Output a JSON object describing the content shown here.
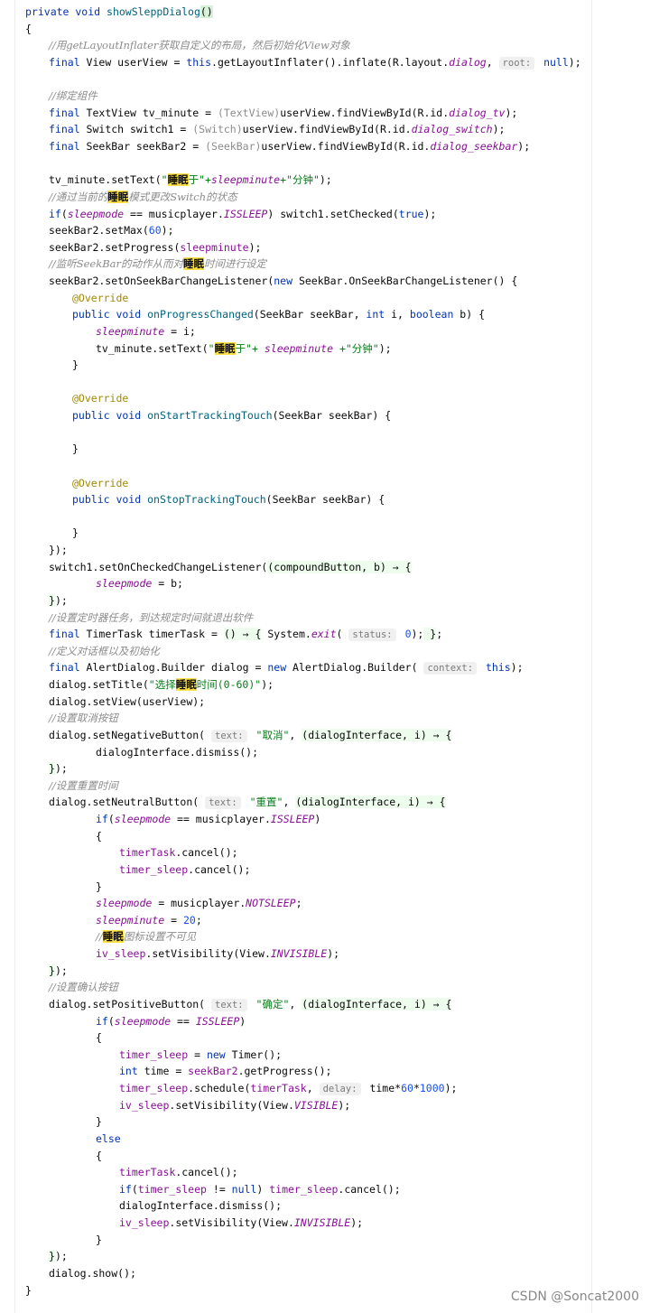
{
  "lines": [
    {
      "i": 0,
      "t": [
        [
          "kw",
          "private void "
        ],
        [
          "mname",
          "showSleppDialog"
        ],
        [
          "hlbrace",
          "()"
        ]
      ]
    },
    {
      "i": 0,
      "t": [
        [
          "p",
          "{"
        ]
      ]
    },
    {
      "i": 1,
      "t": [
        [
          "cm",
          "//用getLayoutInflater获取自定义的布局，然后初始化View对象"
        ]
      ]
    },
    {
      "i": 1,
      "t": [
        [
          "kw",
          "final "
        ],
        [
          "p",
          "View userView = "
        ],
        [
          "kw",
          "this"
        ],
        [
          "p",
          ".getLayoutInflater().inflate(R.layout."
        ],
        [
          "ital",
          "dialog"
        ],
        [
          "p",
          ", "
        ],
        [
          "hint",
          "root:"
        ],
        [
          "kw",
          " null"
        ],
        [
          "p",
          ");"
        ]
      ]
    },
    {
      "i": 1,
      "t": [
        [
          "p",
          ""
        ]
      ]
    },
    {
      "i": 1,
      "t": [
        [
          "cm",
          "//绑定组件"
        ]
      ]
    },
    {
      "i": 1,
      "t": [
        [
          "kw",
          "final "
        ],
        [
          "p",
          "TextView tv_minute = "
        ],
        [
          "cast",
          "(TextView)"
        ],
        [
          "p",
          "userView.findViewById(R.id."
        ],
        [
          "ital",
          "dialog_tv"
        ],
        [
          "p",
          ");"
        ]
      ]
    },
    {
      "i": 1,
      "t": [
        [
          "kw",
          "final "
        ],
        [
          "p",
          "Switch switch1 = "
        ],
        [
          "cast",
          "(Switch)"
        ],
        [
          "p",
          "userView.findViewById(R.id."
        ],
        [
          "ital",
          "dialog_switch"
        ],
        [
          "p",
          ");"
        ]
      ]
    },
    {
      "i": 1,
      "t": [
        [
          "kw",
          "final "
        ],
        [
          "p",
          "SeekBar seekBar2 = "
        ],
        [
          "cast",
          "(SeekBar)"
        ],
        [
          "p",
          "userView.findViewById(R.id."
        ],
        [
          "ital",
          "dialog_seekbar"
        ],
        [
          "p",
          ");"
        ]
      ]
    },
    {
      "i": 1,
      "t": [
        [
          "p",
          ""
        ]
      ]
    },
    {
      "i": 1,
      "t": [
        [
          "p",
          "tv_minute.setText("
        ],
        [
          "str",
          "\""
        ],
        [
          "hlw",
          "睡眠"
        ],
        [
          "str",
          "于\"+"
        ],
        [
          "field",
          "sleepminute"
        ],
        [
          "str",
          "+\"分钟\""
        ],
        [
          "p",
          ");"
        ]
      ]
    },
    {
      "i": 1,
      "t": [
        [
          "cm",
          "//通过当前的"
        ],
        [
          "hlw",
          "睡眠"
        ],
        [
          "cm",
          "模式更改Switch的状态"
        ]
      ]
    },
    {
      "i": 1,
      "t": [
        [
          "kw",
          "if"
        ],
        [
          "p",
          "("
        ],
        [
          "field",
          "sleepmode"
        ],
        [
          "p",
          " == musicplayer."
        ],
        [
          "stat",
          "ISSLEEP"
        ],
        [
          "p",
          ") switch1.setChecked("
        ],
        [
          "kw",
          "true"
        ],
        [
          "p",
          ");"
        ]
      ]
    },
    {
      "i": 1,
      "t": [
        [
          "p",
          "seekBar2.setMax("
        ],
        [
          "num",
          "60"
        ],
        [
          "p",
          ");"
        ]
      ]
    },
    {
      "i": 1,
      "t": [
        [
          "p",
          "seekBar2.setProgress("
        ],
        [
          "var",
          "sleepminute"
        ],
        [
          "p",
          ");"
        ]
      ]
    },
    {
      "i": 1,
      "t": [
        [
          "cm",
          "//监听SeekBar的动作从而对"
        ],
        [
          "hlw",
          "睡眠"
        ],
        [
          "cm",
          "时间进行设定"
        ]
      ]
    },
    {
      "i": 1,
      "t": [
        [
          "p",
          "seekBar2.setOnSeekBarChangeListener("
        ],
        [
          "kw",
          "new "
        ],
        [
          "p",
          "SeekBar.OnSeekBarChangeListener() {"
        ]
      ]
    },
    {
      "i": 2,
      "t": [
        [
          "ann",
          "@Override"
        ]
      ]
    },
    {
      "i": 2,
      "t": [
        [
          "kw",
          "public void "
        ],
        [
          "mname",
          "onProgressChanged"
        ],
        [
          "p",
          "(SeekBar seekBar, "
        ],
        [
          "kw",
          "int "
        ],
        [
          "p",
          "i, "
        ],
        [
          "kw",
          "boolean "
        ],
        [
          "p",
          "b) {"
        ]
      ]
    },
    {
      "i": 3,
      "t": [
        [
          "field",
          "sleepminute"
        ],
        [
          "p",
          " = i;"
        ]
      ]
    },
    {
      "i": 3,
      "t": [
        [
          "p",
          "tv_minute.setText("
        ],
        [
          "str",
          "\""
        ],
        [
          "hlw",
          "睡眠"
        ],
        [
          "str",
          "于\"+ "
        ],
        [
          "field",
          "sleepminute"
        ],
        [
          "str",
          " +\"分钟\""
        ],
        [
          "p",
          ");"
        ]
      ]
    },
    {
      "i": 2,
      "t": [
        [
          "p",
          "}"
        ]
      ]
    },
    {
      "i": 2,
      "t": [
        [
          "p",
          ""
        ]
      ]
    },
    {
      "i": 2,
      "t": [
        [
          "ann",
          "@Override"
        ]
      ]
    },
    {
      "i": 2,
      "t": [
        [
          "kw",
          "public void "
        ],
        [
          "mname",
          "onStartTrackingTouch"
        ],
        [
          "p",
          "(SeekBar seekBar) {"
        ]
      ]
    },
    {
      "i": 2,
      "t": [
        [
          "p",
          ""
        ]
      ]
    },
    {
      "i": 2,
      "t": [
        [
          "p",
          "}"
        ]
      ]
    },
    {
      "i": 2,
      "t": [
        [
          "p",
          ""
        ]
      ]
    },
    {
      "i": 2,
      "t": [
        [
          "ann",
          "@Override"
        ]
      ]
    },
    {
      "i": 2,
      "t": [
        [
          "kw",
          "public void "
        ],
        [
          "mname",
          "onStopTrackingTouch"
        ],
        [
          "p",
          "(SeekBar seekBar) {"
        ]
      ]
    },
    {
      "i": 2,
      "t": [
        [
          "p",
          ""
        ]
      ]
    },
    {
      "i": 2,
      "t": [
        [
          "p",
          "}"
        ]
      ]
    },
    {
      "i": 1,
      "t": [
        [
          "p",
          "});"
        ]
      ]
    },
    {
      "i": 1,
      "t": [
        [
          "p",
          "switch1.setOnCheckedChangeListener("
        ],
        [
          "lam",
          "(compoundButton, b) → {"
        ]
      ]
    },
    {
      "i": 3,
      "t": [
        [
          "field",
          "sleepmode"
        ],
        [
          "p",
          " = b;"
        ]
      ]
    },
    {
      "i": 1,
      "t": [
        [
          "lam",
          "}"
        ],
        [
          "p",
          ");"
        ]
      ]
    },
    {
      "i": 1,
      "t": [
        [
          "cm",
          "//设置定时器任务，到达规定时间就退出软件"
        ]
      ]
    },
    {
      "i": 1,
      "t": [
        [
          "kw",
          "final "
        ],
        [
          "p",
          "TimerTask timerTask = "
        ],
        [
          "lam",
          "() → {"
        ],
        [
          "p",
          " System."
        ],
        [
          "stat",
          "exit"
        ],
        [
          "p",
          "( "
        ],
        [
          "hint",
          "status:"
        ],
        [
          "num",
          " 0"
        ],
        [
          "p",
          ");"
        ],
        [
          "lam",
          " }"
        ],
        [
          "p",
          ";"
        ]
      ]
    },
    {
      "i": 1,
      "t": [
        [
          "cm",
          "//定义对话框以及初始化"
        ]
      ]
    },
    {
      "i": 1,
      "t": [
        [
          "kw",
          "final "
        ],
        [
          "p",
          "AlertDialog.Builder dialog = "
        ],
        [
          "kw",
          "new "
        ],
        [
          "p",
          "AlertDialog.Builder( "
        ],
        [
          "hint",
          "context:"
        ],
        [
          "kw",
          " this"
        ],
        [
          "p",
          ");"
        ]
      ]
    },
    {
      "i": 1,
      "t": [
        [
          "p",
          "dialog.setTitle("
        ],
        [
          "str",
          "\"选择"
        ],
        [
          "hlw",
          "睡眠"
        ],
        [
          "str",
          "时间(0-60)\""
        ],
        [
          "p",
          ");"
        ]
      ]
    },
    {
      "i": 1,
      "t": [
        [
          "p",
          "dialog.setView(userView);"
        ]
      ]
    },
    {
      "i": 1,
      "t": [
        [
          "cm",
          "//设置取消按钮"
        ]
      ]
    },
    {
      "i": 1,
      "t": [
        [
          "p",
          "dialog.setNegativeButton( "
        ],
        [
          "hint",
          "text:"
        ],
        [
          "str",
          " \"取消\""
        ],
        [
          "p",
          ", "
        ],
        [
          "lam",
          "(dialogInterface, i) → {"
        ]
      ]
    },
    {
      "i": 3,
      "t": [
        [
          "p",
          "dialogInterface.dismiss();"
        ]
      ]
    },
    {
      "i": 1,
      "t": [
        [
          "lam",
          "}"
        ],
        [
          "p",
          ");"
        ]
      ]
    },
    {
      "i": 1,
      "t": [
        [
          "cm",
          "//设置重置时间"
        ]
      ]
    },
    {
      "i": 1,
      "t": [
        [
          "p",
          "dialog.setNeutralButton( "
        ],
        [
          "hint",
          "text:"
        ],
        [
          "str",
          " \"重置\""
        ],
        [
          "p",
          ", "
        ],
        [
          "lam",
          "(dialogInterface, i) → {"
        ]
      ]
    },
    {
      "i": 3,
      "t": [
        [
          "kw",
          "if"
        ],
        [
          "p",
          "("
        ],
        [
          "field",
          "sleepmode"
        ],
        [
          "p",
          " == musicplayer."
        ],
        [
          "stat",
          "ISSLEEP"
        ],
        [
          "p",
          ")"
        ]
      ]
    },
    {
      "i": 3,
      "t": [
        [
          "p",
          "{"
        ]
      ]
    },
    {
      "i": 4,
      "t": [
        [
          "var",
          "timerTask"
        ],
        [
          "p",
          ".cancel();"
        ]
      ]
    },
    {
      "i": 4,
      "t": [
        [
          "var",
          "timer_sleep"
        ],
        [
          "p",
          ".cancel();"
        ]
      ]
    },
    {
      "i": 3,
      "t": [
        [
          "p",
          "}"
        ]
      ]
    },
    {
      "i": 3,
      "t": [
        [
          "field",
          "sleepmode"
        ],
        [
          "p",
          " = musicplayer."
        ],
        [
          "stat",
          "NOTSLEEP"
        ],
        [
          "p",
          ";"
        ]
      ]
    },
    {
      "i": 3,
      "t": [
        [
          "field",
          "sleepminute"
        ],
        [
          "p",
          " = "
        ],
        [
          "num",
          "20"
        ],
        [
          "p",
          ";"
        ]
      ]
    },
    {
      "i": 3,
      "t": [
        [
          "cm",
          "//"
        ],
        [
          "hlw",
          "睡眠"
        ],
        [
          "cm",
          "图标设置不可见"
        ]
      ]
    },
    {
      "i": 3,
      "t": [
        [
          "var",
          "iv_sleep"
        ],
        [
          "p",
          ".setVisibility(View."
        ],
        [
          "stat",
          "INVISIBLE"
        ],
        [
          "p",
          ");"
        ]
      ]
    },
    {
      "i": 1,
      "t": [
        [
          "lam",
          "}"
        ],
        [
          "p",
          ");"
        ]
      ]
    },
    {
      "i": 1,
      "t": [
        [
          "cm",
          "//设置确认按钮"
        ]
      ]
    },
    {
      "i": 1,
      "t": [
        [
          "p",
          "dialog.setPositiveButton( "
        ],
        [
          "hint",
          "text:"
        ],
        [
          "str",
          " \"确定\""
        ],
        [
          "p",
          ", "
        ],
        [
          "lam",
          "(dialogInterface, i) → {"
        ]
      ]
    },
    {
      "i": 3,
      "t": [
        [
          "kw",
          "if"
        ],
        [
          "p",
          "("
        ],
        [
          "field",
          "sleepmode"
        ],
        [
          "p",
          " == "
        ],
        [
          "stat",
          "ISSLEEP"
        ],
        [
          "p",
          ")"
        ]
      ]
    },
    {
      "i": 3,
      "t": [
        [
          "p",
          "{"
        ]
      ]
    },
    {
      "i": 4,
      "t": [
        [
          "var",
          "timer_sleep"
        ],
        [
          "p",
          " = "
        ],
        [
          "kw",
          "new "
        ],
        [
          "p",
          "Timer();"
        ]
      ]
    },
    {
      "i": 4,
      "t": [
        [
          "kw",
          "int "
        ],
        [
          "p",
          "time = "
        ],
        [
          "var",
          "seekBar2"
        ],
        [
          "p",
          ".getProgress();"
        ]
      ]
    },
    {
      "i": 4,
      "t": [
        [
          "var",
          "timer_sleep"
        ],
        [
          "p",
          ".schedule("
        ],
        [
          "var",
          "timerTask"
        ],
        [
          "p",
          ", "
        ],
        [
          "hint",
          "delay:"
        ],
        [
          "p",
          " time*"
        ],
        [
          "num",
          "60"
        ],
        [
          "p",
          "*"
        ],
        [
          "num",
          "1000"
        ],
        [
          "p",
          ");"
        ]
      ]
    },
    {
      "i": 4,
      "t": [
        [
          "var",
          "iv_sleep"
        ],
        [
          "p",
          ".setVisibility(View."
        ],
        [
          "stat",
          "VISIBLE"
        ],
        [
          "p",
          ");"
        ]
      ]
    },
    {
      "i": 3,
      "t": [
        [
          "p",
          "}"
        ]
      ]
    },
    {
      "i": 3,
      "t": [
        [
          "kw",
          "else"
        ]
      ]
    },
    {
      "i": 3,
      "t": [
        [
          "p",
          "{"
        ]
      ]
    },
    {
      "i": 4,
      "t": [
        [
          "var",
          "timerTask"
        ],
        [
          "p",
          ".cancel();"
        ]
      ]
    },
    {
      "i": 4,
      "t": [
        [
          "kw",
          "if"
        ],
        [
          "p",
          "("
        ],
        [
          "var",
          "timer_sleep"
        ],
        [
          "p",
          " != "
        ],
        [
          "kw",
          "null"
        ],
        [
          "p",
          ") "
        ],
        [
          "var",
          "timer_sleep"
        ],
        [
          "p",
          ".cancel();"
        ]
      ]
    },
    {
      "i": 4,
      "t": [
        [
          "p",
          "dialogInterface.dismiss();"
        ]
      ]
    },
    {
      "i": 4,
      "t": [
        [
          "var",
          "iv_sleep"
        ],
        [
          "p",
          ".setVisibility(View."
        ],
        [
          "stat",
          "INVISIBLE"
        ],
        [
          "p",
          ");"
        ]
      ]
    },
    {
      "i": 3,
      "t": [
        [
          "p",
          "}"
        ]
      ]
    },
    {
      "i": 1,
      "t": [
        [
          "lam",
          "}"
        ],
        [
          "p",
          ");"
        ]
      ]
    },
    {
      "i": 1,
      "t": [
        [
          "p",
          "dialog.show();"
        ]
      ]
    },
    {
      "i": 0,
      "t": [
        [
          "p",
          "}"
        ]
      ]
    }
  ],
  "watermark": "CSDN @Soncat2000"
}
